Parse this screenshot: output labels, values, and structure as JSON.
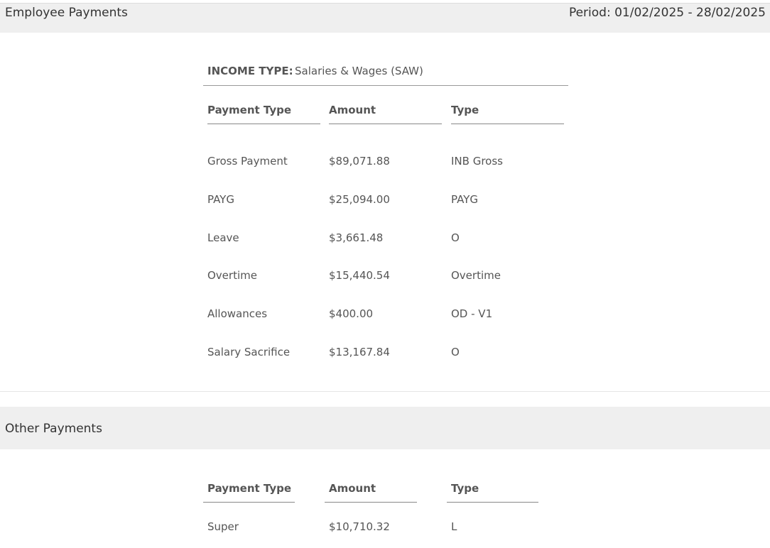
{
  "employee_section": {
    "title": "Employee Payments",
    "period": "Period: 01/02/2025 - 28/02/2025",
    "income_type_label": "INCOME TYPE:",
    "income_type_value": "Salaries & Wages (SAW)",
    "columns": [
      "Payment Type",
      "Amount",
      "Type"
    ],
    "rows": [
      {
        "payment_type": "Gross Payment",
        "amount": "$89,071.88",
        "type": "INB Gross"
      },
      {
        "payment_type": "PAYG",
        "amount": "$25,094.00",
        "type": "PAYG"
      },
      {
        "payment_type": "Leave",
        "amount": "$3,661.48",
        "type": "O"
      },
      {
        "payment_type": "Overtime",
        "amount": "$15,440.54",
        "type": "Overtime"
      },
      {
        "payment_type": "Allowances",
        "amount": "$400.00",
        "type": "OD - V1"
      },
      {
        "payment_type": "Salary Sacrifice",
        "amount": "$13,167.84",
        "type": "O"
      }
    ]
  },
  "other_section": {
    "title": "Other Payments",
    "columns": [
      "Payment Type",
      "Amount",
      "Type"
    ],
    "rows": [
      {
        "payment_type": "Super",
        "amount": "$10,710.32",
        "type": "L"
      }
    ]
  }
}
